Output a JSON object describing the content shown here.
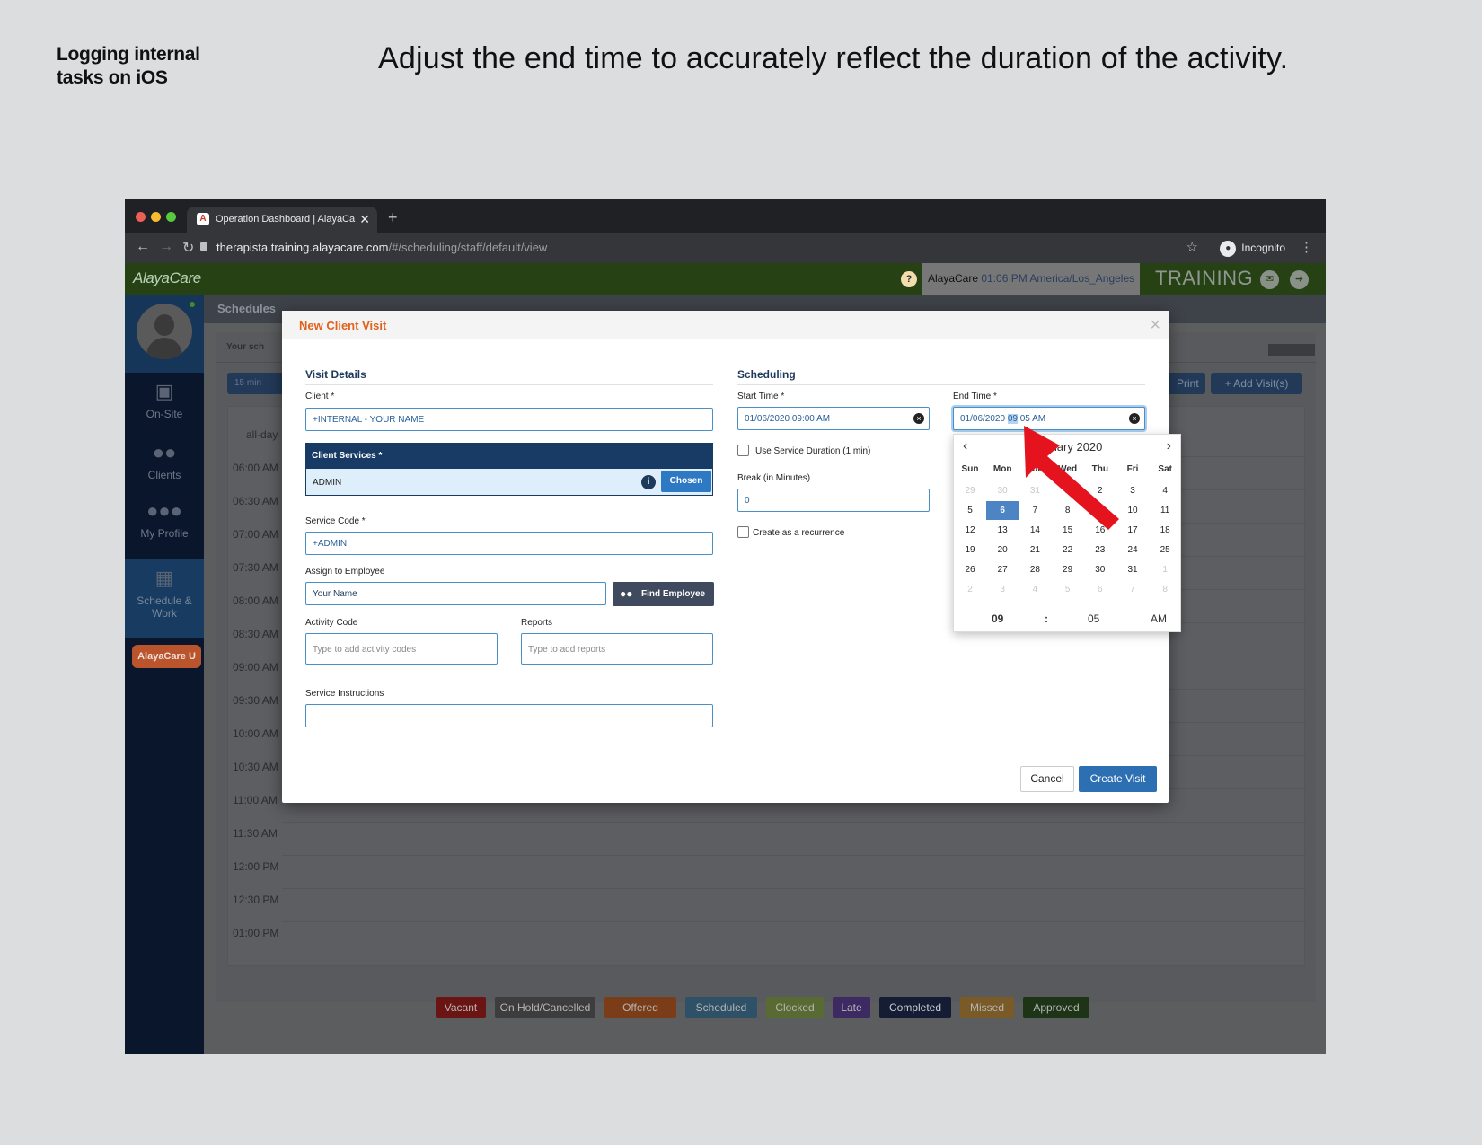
{
  "slide": {
    "label": "Logging internal tasks on iOS",
    "instruction": "Adjust the end time to accurately reflect the duration of the activity."
  },
  "browser": {
    "tab_title": "Operation Dashboard | AlayaCa",
    "tab_close": "✕",
    "new_tab": "+",
    "url_host": "therapista.training.alayacare.com",
    "url_path": "/#/scheduling/staff/default/view",
    "incognito_label": "Incognito"
  },
  "appbar": {
    "logo": "AlayaCare",
    "help": "?",
    "company": "AlayaCare",
    "time_tz": "01:06 PM  America/Los_Angeles",
    "env_label": "TRAINING"
  },
  "sidebar": {
    "items": [
      {
        "label": "On-Site",
        "icon": "monitor-icon"
      },
      {
        "label": "Clients",
        "icon": "clients-icon"
      },
      {
        "label": "My Profile",
        "icon": "profile-icon"
      },
      {
        "label": "Schedule & Work",
        "icon": "calendar-icon"
      }
    ],
    "academy_button": "AlayaCare U"
  },
  "schedule": {
    "title": "Schedules",
    "your_schedule": "Your sch",
    "bar_values": [
      "0",
      "0"
    ],
    "interval": "15 min",
    "print_label": "Print",
    "add_visit_label": "+ Add Visit(s)",
    "all_day": "all-day",
    "times": [
      "06:00 AM",
      "06:30 AM",
      "07:00 AM",
      "07:30 AM",
      "08:00 AM",
      "08:30 AM",
      "09:00 AM",
      "09:30 AM",
      "10:00 AM",
      "10:30 AM",
      "11:00 AM",
      "11:30 AM",
      "12:00 PM",
      "12:30 PM",
      "01:00 PM"
    ],
    "legend": [
      {
        "label": "Vacant",
        "color": "#6b1414"
      },
      {
        "label": "On Hold/Cancelled",
        "color": "#3d3d3d"
      },
      {
        "label": "Offered",
        "color": "#7a3d18"
      },
      {
        "label": "Scheduled",
        "color": "#2f5168"
      },
      {
        "label": "Clocked",
        "color": "#596a32"
      },
      {
        "label": "Late",
        "color": "#3e2a63"
      },
      {
        "label": "Completed",
        "color": "#141d34"
      },
      {
        "label": "Missed",
        "color": "#7a5a26"
      },
      {
        "label": "Approved",
        "color": "#1d3417"
      }
    ]
  },
  "modal": {
    "title": "New Client Visit",
    "close": "×",
    "visit_details": {
      "heading": "Visit Details",
      "client_label": "Client *",
      "client_value": "+INTERNAL - YOUR NAME",
      "client_services_label": "Client Services *",
      "client_service_value": "ADMIN",
      "chosen_label": "Chosen",
      "service_code_label": "Service Code *",
      "service_code_value": "+ADMIN",
      "assign_label": "Assign to Employee",
      "assign_value": "Your Name",
      "find_employee": "Find Employee",
      "activity_code_label": "Activity Code",
      "activity_code_placeholder": "Type to add activity codes",
      "reports_label": "Reports",
      "reports_placeholder": "Type to add reports",
      "instructions_label": "Service Instructions",
      "instructions_value": ""
    },
    "scheduling": {
      "heading": "Scheduling",
      "start_label": "Start Time *",
      "start_value": "01/06/2020 09:00 AM",
      "end_label": "End Time *",
      "end_value_pre": "01/06/2020 ",
      "end_value_hl": "09",
      "end_value_post": ":05 AM",
      "use_duration": "Use Service Duration (1 min)",
      "break_label": "Break (in Minutes)",
      "break_value": "0",
      "recurrence": "Create as a recurrence"
    },
    "cancel": "Cancel",
    "create": "Create Visit"
  },
  "datepicker": {
    "month": "January 2020",
    "dows": [
      "Sun",
      "Mon",
      "Tue",
      "Wed",
      "Thu",
      "Fri",
      "Sat"
    ],
    "weeks": [
      [
        "29",
        "30",
        "31",
        "1",
        "2",
        "3",
        "4"
      ],
      [
        "5",
        "6",
        "7",
        "8",
        "9",
        "10",
        "11"
      ],
      [
        "12",
        "13",
        "14",
        "15",
        "16",
        "17",
        "18"
      ],
      [
        "19",
        "20",
        "21",
        "22",
        "23",
        "24",
        "25"
      ],
      [
        "26",
        "27",
        "28",
        "29",
        "30",
        "31",
        "1"
      ],
      [
        "2",
        "3",
        "4",
        "5",
        "6",
        "7",
        "8"
      ]
    ],
    "selected": "6",
    "hour": "09",
    "separator": ":",
    "minute": "05",
    "ampm": "AM"
  },
  "annotation": {
    "arrow_color": "#e5131d"
  }
}
